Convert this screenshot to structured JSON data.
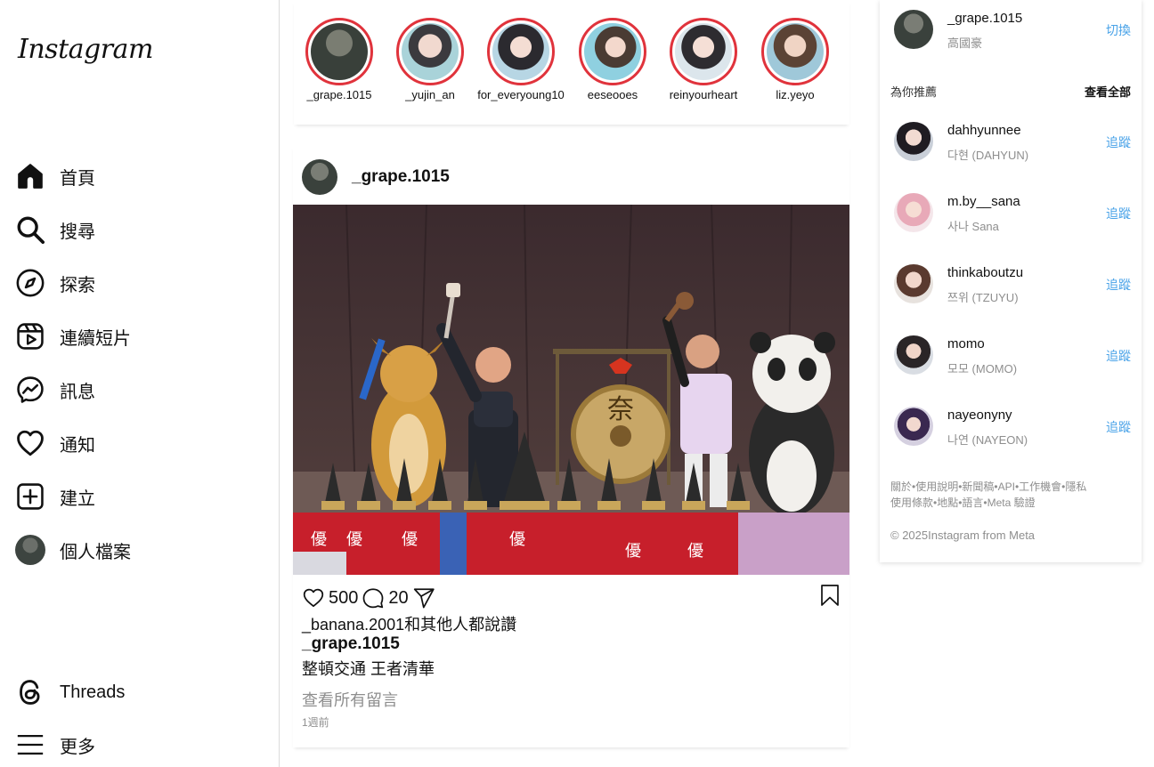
{
  "sidebar": {
    "logo": "Instagram",
    "items": [
      {
        "label": "首頁",
        "icon": "home-icon"
      },
      {
        "label": "搜尋",
        "icon": "search-icon"
      },
      {
        "label": "探索",
        "icon": "compass-icon"
      },
      {
        "label": "連續短片",
        "icon": "reels-icon"
      },
      {
        "label": "訊息",
        "icon": "messenger-icon"
      },
      {
        "label": "通知",
        "icon": "heart-icon"
      },
      {
        "label": "建立",
        "icon": "plus-square-icon"
      },
      {
        "label": "個人檔案",
        "icon": "profile-avatar"
      }
    ],
    "threads": {
      "label": "Threads",
      "icon": "threads-icon"
    },
    "more": {
      "label": "更多",
      "icon": "hamburger-icon"
    }
  },
  "stories": [
    {
      "name": "_grape.1015"
    },
    {
      "name": "_yujin_an"
    },
    {
      "name": "for_everyoung10"
    },
    {
      "name": "eeseooes"
    },
    {
      "name": "reinyourheart"
    },
    {
      "name": "liz.yeyo"
    }
  ],
  "post": {
    "username": "_grape.1015",
    "likes": "500",
    "comments": "20",
    "liked_by": "_banana.2001和其他人都說讚",
    "caption_user": "_grape.1015",
    "caption_text": "整頓交通 王者清華",
    "view_comments": "查看所有留言",
    "time": "1週前",
    "image": {
      "gong_text": "奈",
      "banner_char": "優",
      "icons": [
        "heart-icon",
        "comment-icon",
        "share-icon",
        "bookmark-icon"
      ]
    }
  },
  "right_panel": {
    "current_user": {
      "username": "_grape.1015",
      "name": "高國豪",
      "action": "切換"
    },
    "suggest_title": "為你推薦",
    "see_all": "查看全部",
    "suggestions": [
      {
        "username": "dahhyunnee",
        "sub": "다현 (DAHYUN)",
        "action": "追蹤"
      },
      {
        "username": "m.by__sana",
        "sub": "사나 Sana",
        "action": "追蹤"
      },
      {
        "username": "thinkaboutzu",
        "sub": "쯔위 (TZUYU)",
        "action": "追蹤"
      },
      {
        "username": "momo",
        "sub": "모모 (MOMO)",
        "action": "追蹤"
      },
      {
        "username": "nayeonyny",
        "sub": "나연 (NAYEON)",
        "action": "追蹤"
      }
    ],
    "footer_line1": "關於•使用說明•新聞稿•API•工作機會•隱私",
    "footer_line2": "使用條款•地點•語言•Meta 驗證",
    "copyright": "© 2025Instagram from Meta"
  }
}
